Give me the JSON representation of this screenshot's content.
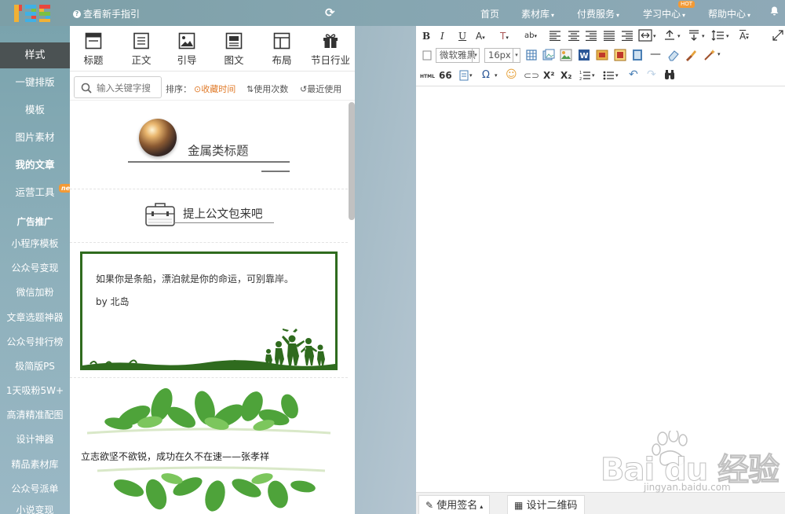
{
  "header": {
    "logo_text": "135",
    "guide_label": "查看新手指引",
    "nav": [
      {
        "label": "首页",
        "has_caret": false
      },
      {
        "label": "素材库",
        "has_caret": true
      },
      {
        "label": "付费服务",
        "has_caret": true
      },
      {
        "label": "学习中心",
        "has_caret": true
      },
      {
        "label": "帮助中心",
        "has_caret": true
      }
    ],
    "hot_badge": "HOT",
    "caret": "▾"
  },
  "sidebar": {
    "items": [
      {
        "label": "样式",
        "active": true
      },
      {
        "label": "一键排版"
      },
      {
        "label": "模板"
      },
      {
        "label": "图片素材"
      },
      {
        "label": "我的文章",
        "bold": true
      },
      {
        "label": "运营工具"
      }
    ],
    "new_badge": "new",
    "ad_heading": "广告推广",
    "ad_items": [
      "小程序模板",
      "公众号变现",
      "微信加粉",
      "文章选题神器",
      "公众号排行榜",
      "极简版PS",
      "1天吸粉5W+",
      "高清精准配图",
      "设计神器",
      "精品素材库",
      "公众号派单",
      "小说变现"
    ]
  },
  "style_panel": {
    "tabs": [
      {
        "label": "标题",
        "icon": "title-icon"
      },
      {
        "label": "正文",
        "icon": "body-text-icon"
      },
      {
        "label": "引导",
        "icon": "image-guide-icon"
      },
      {
        "label": "图文",
        "icon": "image-text-icon"
      },
      {
        "label": "布局",
        "icon": "layout-icon"
      },
      {
        "label": "节日行业",
        "icon": "gift-icon"
      }
    ],
    "search_placeholder": "输入关键字搜",
    "sort_label": "排序：",
    "sort_options": [
      {
        "label": "收藏时间",
        "selected": true
      },
      {
        "label": "使用次数",
        "selected": false
      },
      {
        "label": "最近使用",
        "selected": false
      }
    ],
    "templates": {
      "metal_title": "金属类标题",
      "briefcase_title": "提上公文包来吧",
      "poem_line": "如果你是条船，漂泊就是你的命运，可别靠岸。",
      "poem_author": "by 北岛",
      "quote": "立志欲坚不欲锐，成功在久不在速——张孝祥"
    }
  },
  "editor": {
    "font_family": "微软雅黑",
    "font_size": "16px",
    "toolbar_row1": {
      "bold": "B",
      "italic": "I",
      "underline": "U"
    },
    "toolbar_row3": {
      "html": "HTML",
      "quote": "66",
      "omega": "Ω",
      "superscript": "X²",
      "subscript": "X₂"
    },
    "bottom_buttons": [
      {
        "label": "使用签名",
        "caret": "▴"
      },
      {
        "label": "设计二维码"
      }
    ]
  },
  "watermark": {
    "text": "Bai du 经验",
    "url": "jingyan.baidu.com"
  },
  "colors": {
    "accent_orange": "#e07b2a",
    "sidebar_active": "#4b5253",
    "border_green": "#2f6b1e",
    "badge": "#f39a36"
  }
}
